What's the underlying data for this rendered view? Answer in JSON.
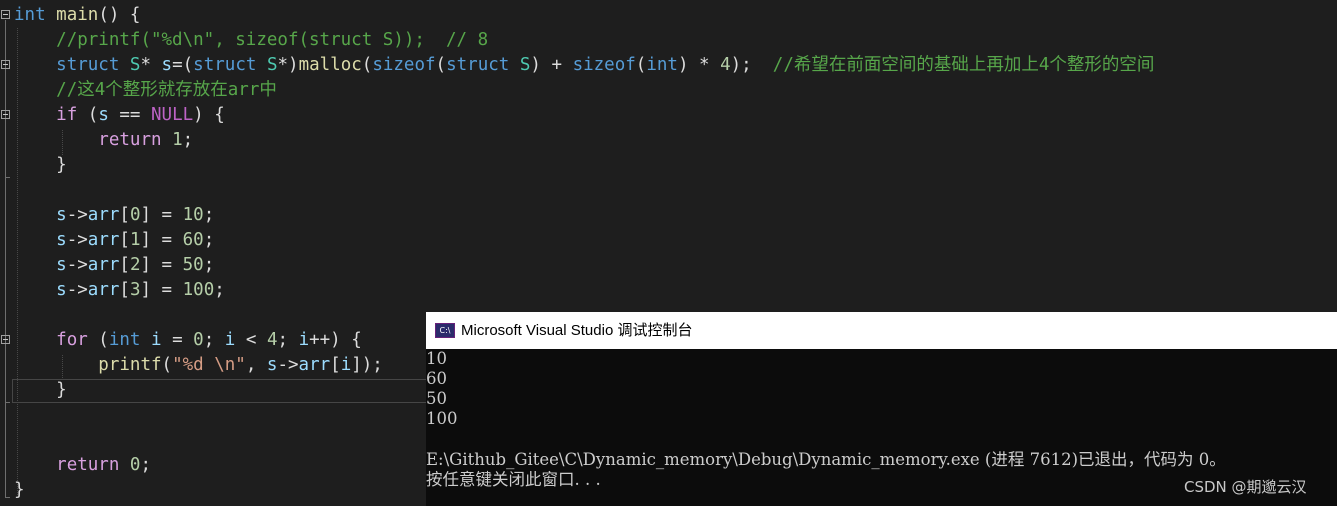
{
  "editor": {
    "lines": [
      {
        "indent": "",
        "tokens": [
          {
            "t": "int",
            "c": "kw"
          },
          {
            "t": " "
          },
          {
            "t": "main",
            "c": "fn"
          },
          {
            "t": "() {"
          }
        ]
      },
      {
        "indent": "    ",
        "tokens": [
          {
            "t": "//printf(\"%d\\n\", sizeof(struct S));  // 8",
            "c": "cmt"
          }
        ]
      },
      {
        "indent": "    ",
        "tokens": [
          {
            "t": "struct",
            "c": "kw"
          },
          {
            "t": " "
          },
          {
            "t": "S",
            "c": "ty"
          },
          {
            "t": "* "
          },
          {
            "t": "s",
            "c": "var"
          },
          {
            "t": "=("
          },
          {
            "t": "struct",
            "c": "kw"
          },
          {
            "t": " "
          },
          {
            "t": "S",
            "c": "ty"
          },
          {
            "t": "*)"
          },
          {
            "t": "malloc",
            "c": "fn"
          },
          {
            "t": "("
          },
          {
            "t": "sizeof",
            "c": "kw"
          },
          {
            "t": "("
          },
          {
            "t": "struct",
            "c": "kw"
          },
          {
            "t": " "
          },
          {
            "t": "S",
            "c": "ty"
          },
          {
            "t": ") + "
          },
          {
            "t": "sizeof",
            "c": "kw"
          },
          {
            "t": "("
          },
          {
            "t": "int",
            "c": "kw"
          },
          {
            "t": ") * "
          },
          {
            "t": "4",
            "c": "num"
          },
          {
            "t": ");  "
          },
          {
            "t": "//希望在前面空间的基础上再加上4个整形的空间",
            "c": "cmt"
          }
        ]
      },
      {
        "indent": "    ",
        "tokens": [
          {
            "t": "//这4个整形就存放在arr中",
            "c": "cmt"
          }
        ]
      },
      {
        "indent": "    ",
        "tokens": [
          {
            "t": "if",
            "c": "ctrl"
          },
          {
            "t": " ("
          },
          {
            "t": "s",
            "c": "var"
          },
          {
            "t": " == "
          },
          {
            "t": "NULL",
            "c": "mac"
          },
          {
            "t": ") {"
          }
        ]
      },
      {
        "indent": "        ",
        "tokens": [
          {
            "t": "return",
            "c": "ctrl"
          },
          {
            "t": " "
          },
          {
            "t": "1",
            "c": "num"
          },
          {
            "t": ";"
          }
        ]
      },
      {
        "indent": "    ",
        "tokens": [
          {
            "t": "}"
          }
        ]
      },
      {
        "indent": "",
        "tokens": []
      },
      {
        "indent": "    ",
        "tokens": [
          {
            "t": "s",
            "c": "var"
          },
          {
            "t": "->"
          },
          {
            "t": "arr",
            "c": "var"
          },
          {
            "t": "["
          },
          {
            "t": "0",
            "c": "num"
          },
          {
            "t": "] = "
          },
          {
            "t": "10",
            "c": "num"
          },
          {
            "t": ";"
          }
        ]
      },
      {
        "indent": "    ",
        "tokens": [
          {
            "t": "s",
            "c": "var"
          },
          {
            "t": "->"
          },
          {
            "t": "arr",
            "c": "var"
          },
          {
            "t": "["
          },
          {
            "t": "1",
            "c": "num"
          },
          {
            "t": "] = "
          },
          {
            "t": "60",
            "c": "num"
          },
          {
            "t": ";"
          }
        ]
      },
      {
        "indent": "    ",
        "tokens": [
          {
            "t": "s",
            "c": "var"
          },
          {
            "t": "->"
          },
          {
            "t": "arr",
            "c": "var"
          },
          {
            "t": "["
          },
          {
            "t": "2",
            "c": "num"
          },
          {
            "t": "] = "
          },
          {
            "t": "50",
            "c": "num"
          },
          {
            "t": ";"
          }
        ]
      },
      {
        "indent": "    ",
        "tokens": [
          {
            "t": "s",
            "c": "var"
          },
          {
            "t": "->"
          },
          {
            "t": "arr",
            "c": "var"
          },
          {
            "t": "["
          },
          {
            "t": "3",
            "c": "num"
          },
          {
            "t": "] = "
          },
          {
            "t": "100",
            "c": "num"
          },
          {
            "t": ";"
          }
        ]
      },
      {
        "indent": "",
        "tokens": []
      },
      {
        "indent": "    ",
        "tokens": [
          {
            "t": "for",
            "c": "ctrl"
          },
          {
            "t": " ("
          },
          {
            "t": "int",
            "c": "kw"
          },
          {
            "t": " "
          },
          {
            "t": "i",
            "c": "var"
          },
          {
            "t": " = "
          },
          {
            "t": "0",
            "c": "num"
          },
          {
            "t": "; "
          },
          {
            "t": "i",
            "c": "var"
          },
          {
            "t": " < "
          },
          {
            "t": "4",
            "c": "num"
          },
          {
            "t": "; "
          },
          {
            "t": "i",
            "c": "var"
          },
          {
            "t": "++) {"
          }
        ]
      },
      {
        "indent": "        ",
        "tokens": [
          {
            "t": "printf",
            "c": "fn"
          },
          {
            "t": "("
          },
          {
            "t": "\"%d \\n\"",
            "c": "str"
          },
          {
            "t": ", "
          },
          {
            "t": "s",
            "c": "var"
          },
          {
            "t": "->"
          },
          {
            "t": "arr",
            "c": "var"
          },
          {
            "t": "["
          },
          {
            "t": "i",
            "c": "var"
          },
          {
            "t": "]);"
          }
        ]
      },
      {
        "indent": "    ",
        "tokens": [
          {
            "t": "}"
          }
        ]
      },
      {
        "indent": "",
        "tokens": []
      },
      {
        "indent": "",
        "tokens": []
      },
      {
        "indent": "    ",
        "tokens": [
          {
            "t": "return",
            "c": "ctrl"
          },
          {
            "t": " "
          },
          {
            "t": "0",
            "c": "num"
          },
          {
            "t": ";"
          }
        ]
      },
      {
        "indent": "",
        "tokens": [
          {
            "t": "}"
          }
        ]
      }
    ]
  },
  "console": {
    "icon_label": "C:\\",
    "title": "Microsoft Visual Studio 调试控制台",
    "output": [
      "10",
      "60",
      "50",
      "100",
      "",
      "E:\\Github_Gitee\\C\\Dynamic_memory\\Debug\\Dynamic_memory.exe (进程 7612)已退出，代码为 0。",
      "按任意键关闭此窗口. . ."
    ]
  },
  "watermark": "CSDN @期邈云汉"
}
